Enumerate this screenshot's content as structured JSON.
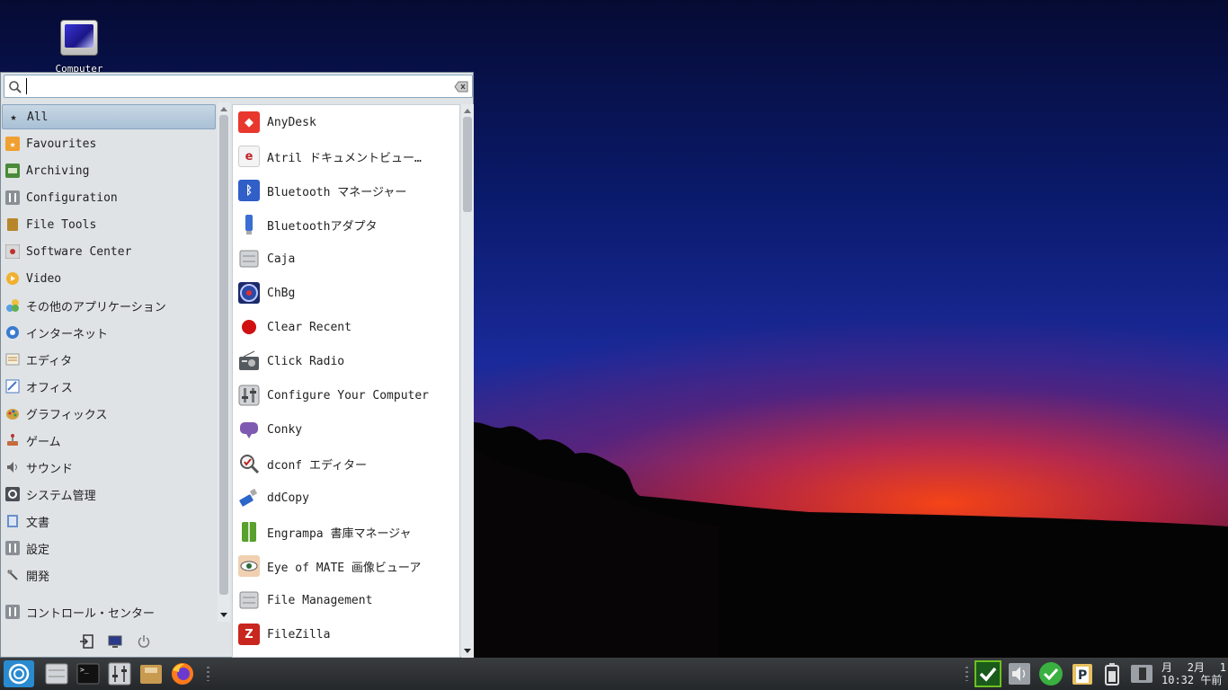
{
  "desktop": {
    "icons": [
      {
        "label": "Computer",
        "icon": "computer-icon"
      }
    ]
  },
  "menu": {
    "search": {
      "value": "",
      "placeholder": ""
    },
    "categories": [
      {
        "label": "All",
        "icon": "star-icon",
        "selected": true
      },
      {
        "label": "Favourites",
        "icon": "favourites-icon"
      },
      {
        "label": "Archiving",
        "icon": "archiving-icon"
      },
      {
        "label": "Configuration",
        "icon": "configuration-icon"
      },
      {
        "label": "File Tools",
        "icon": "file-tools-icon"
      },
      {
        "label": "Software Center",
        "icon": "software-center-icon"
      },
      {
        "label": "Video",
        "icon": "video-icon"
      },
      {
        "label": "その他のアプリケーション",
        "icon": "other-apps-icon"
      },
      {
        "label": "インターネット",
        "icon": "internet-icon"
      },
      {
        "label": "エディタ",
        "icon": "editor-icon"
      },
      {
        "label": "オフィス",
        "icon": "office-icon"
      },
      {
        "label": "グラフィックス",
        "icon": "graphics-icon"
      },
      {
        "label": "ゲーム",
        "icon": "games-icon"
      },
      {
        "label": "サウンド",
        "icon": "sound-icon"
      },
      {
        "label": "システム管理",
        "icon": "system-admin-icon"
      },
      {
        "label": "文書",
        "icon": "documents-icon"
      },
      {
        "label": "設定",
        "icon": "settings-icon"
      },
      {
        "label": "開発",
        "icon": "development-icon"
      }
    ],
    "control_center": {
      "label": "コントロール・センター",
      "icon": "control-center-icon"
    },
    "apps": [
      {
        "label": "AnyDesk",
        "icon": "anydesk-icon",
        "color": "#e8372d"
      },
      {
        "label": "Atril ドキュメントビュー…",
        "icon": "atril-icon",
        "color": "#c0262b"
      },
      {
        "label": "Bluetooth マネージャー",
        "icon": "bluetooth-icon",
        "color": "#2f5fc7"
      },
      {
        "label": "Bluetoothアダプタ",
        "icon": "bluetooth-adapter-icon",
        "color": "#3a6ed1"
      },
      {
        "label": "Caja",
        "icon": "caja-icon",
        "color": "#9aa0a6"
      },
      {
        "label": "ChBg",
        "icon": "chbg-icon",
        "color": "#1a3a8a"
      },
      {
        "label": "Clear Recent",
        "icon": "clear-recent-icon",
        "color": "#d01010"
      },
      {
        "label": "Click Radio",
        "icon": "radio-icon",
        "color": "#555a60"
      },
      {
        "label": "Configure Your Computer",
        "icon": "configure-icon",
        "color": "#7a7f86"
      },
      {
        "label": "Conky",
        "icon": "conky-icon",
        "color": "#7e5ab0"
      },
      {
        "label": "dconf エディター",
        "icon": "dconf-icon",
        "color": "#c02020"
      },
      {
        "label": "ddCopy",
        "icon": "ddcopy-icon",
        "color": "#2c66c8"
      },
      {
        "label": "Engrampa 書庫マネージャ",
        "icon": "engrampa-icon",
        "color": "#5aa02c"
      },
      {
        "label": "Eye of MATE 画像ビューア",
        "icon": "eye-of-mate-icon",
        "color": "#c98a40"
      },
      {
        "label": "File Management",
        "icon": "file-management-icon",
        "color": "#9aa0a6"
      },
      {
        "label": "FileZilla",
        "icon": "filezilla-icon",
        "color": "#c8261e"
      }
    ],
    "bottom_buttons": [
      {
        "icon": "logout-icon"
      },
      {
        "icon": "lock-screen-icon"
      },
      {
        "icon": "power-icon"
      }
    ]
  },
  "taskbar": {
    "launchers": [
      {
        "icon": "start-menu-icon"
      },
      {
        "icon": "file-manager-icon"
      },
      {
        "icon": "terminal-icon"
      },
      {
        "icon": "mixer-icon"
      },
      {
        "icon": "archive-manager-icon"
      },
      {
        "icon": "firefox-icon"
      }
    ],
    "tray": [
      {
        "icon": "update-check-icon"
      },
      {
        "icon": "volume-icon"
      },
      {
        "icon": "check-ok-icon"
      },
      {
        "icon": "clipboard-icon"
      },
      {
        "icon": "battery-icon"
      },
      {
        "icon": "network-icon"
      }
    ],
    "clock": {
      "month_label": "月",
      "date": "2月",
      "day": "1",
      "time": "10:32 午前"
    }
  }
}
